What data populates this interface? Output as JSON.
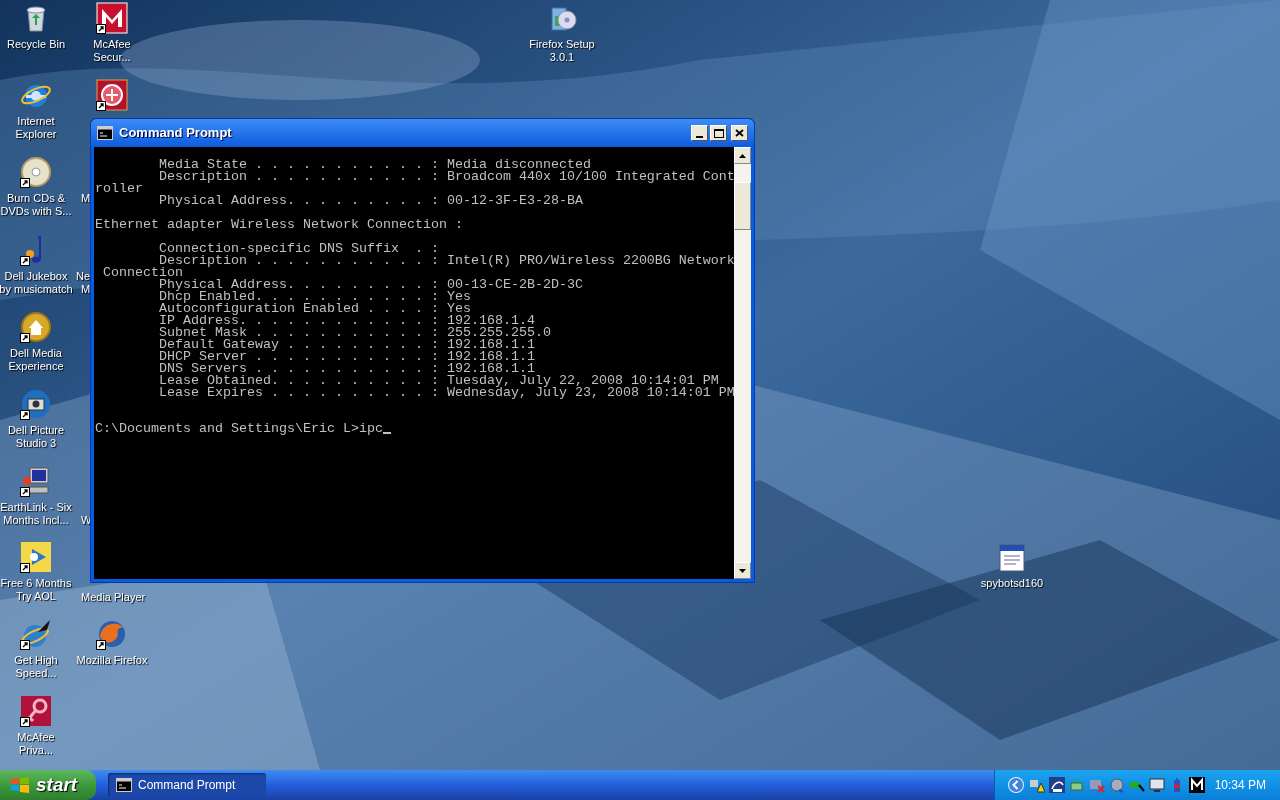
{
  "desktop_icons": [
    {
      "label": [
        "Recycle Bin"
      ],
      "shortcut": false
    },
    {
      "label": [
        "McAfee",
        "Secur..."
      ],
      "shortcut": true
    },
    {
      "label": [
        "Firefox Setup",
        "3.0.1"
      ],
      "shortcut": false
    },
    {
      "label": [
        "Internet",
        "Explorer"
      ],
      "shortcut": false
    },
    {
      "shortcut": true
    },
    {
      "label": [
        "Burn CDs &",
        "DVDs with S..."
      ],
      "shortcut": true
    },
    {
      "label": [
        "M"
      ]
    },
    {
      "label": [
        "Dell Jukebox",
        "by musicmatch"
      ],
      "shortcut": true
    },
    {
      "label": [
        "Ne",
        "M"
      ]
    },
    {
      "label": [
        "Dell Media",
        "Experience"
      ],
      "shortcut": true
    },
    {
      "label": [
        "Dell Picture",
        "Studio 3"
      ],
      "shortcut": true
    },
    {
      "label": [
        "EarthLink - Six",
        "Months Incl..."
      ],
      "shortcut": true
    },
    {
      "label": [
        "W"
      ]
    },
    {
      "label": [
        "Free 6 Months",
        "Try AOL"
      ],
      "shortcut": true
    },
    {
      "label": [
        "Media Player"
      ]
    },
    {
      "label": [
        "Get High",
        "Speed..."
      ],
      "shortcut": true
    },
    {
      "label": [
        "Mozilla Firefox"
      ],
      "shortcut": true
    },
    {
      "label": [
        "spybotsd160"
      ],
      "shortcut": false
    },
    {
      "label": [
        "McAfee",
        "Priva..."
      ],
      "shortcut": true
    }
  ],
  "window": {
    "title": "Command Prompt",
    "console_blocks": [
      [
        "        Media State . . . . . . . . . . . : Media disconnected",
        "        Description . . . . . . . . . . . : Broadcom 440x 10/100 Integrated Cont",
        "roller",
        "        Physical Address. . . . . . . . . : 00-12-3F-E3-28-BA"
      ],
      [
        "Ethernet adapter Wireless Network Connection :"
      ],
      [
        "        Connection-specific DNS Suffix  . :",
        "        Description . . . . . . . . . . . : Intel(R) PRO/Wireless 2200BG Network",
        " Connection",
        "        Physical Address. . . . . . . . . : 00-13-CE-2B-2D-3C",
        "        Dhcp Enabled. . . . . . . . . . . : Yes",
        "        Autoconfiguration Enabled . . . . : Yes",
        "        IP Address. . . . . . . . . . . . : 192.168.1.4",
        "        Subnet Mask . . . . . . . . . . . : 255.255.255.0",
        "        Default Gateway . . . . . . . . . : 192.168.1.1",
        "        DHCP Server . . . . . . . . . . . : 192.168.1.1",
        "        DNS Servers . . . . . . . . . . . : 192.168.1.1",
        "        Lease Obtained. . . . . . . . . . : Tuesday, July 22, 2008 10:14:01 PM",
        "        Lease Expires . . . . . . . . . . : Wednesday, July 23, 2008 10:14:01 PM"
      ]
    ],
    "prompt": "C:\\Documents and Settings\\Eric L>ipc"
  },
  "taskbar": {
    "start": "start",
    "tasks": [
      {
        "label": "Command Prompt",
        "selected": true
      }
    ],
    "clock": "10:34 PM"
  }
}
